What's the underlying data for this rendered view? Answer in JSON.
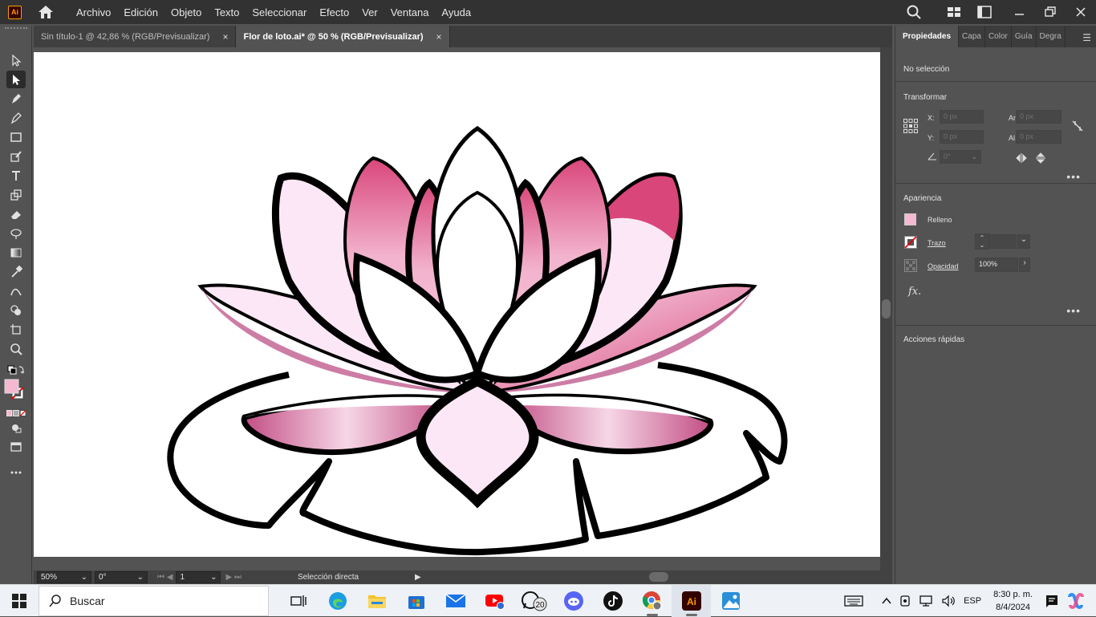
{
  "app": {
    "logo_text": "Ai"
  },
  "menu": [
    "Archivo",
    "Edición",
    "Objeto",
    "Texto",
    "Seleccionar",
    "Efecto",
    "Ver",
    "Ventana",
    "Ayuda"
  ],
  "tabs": [
    {
      "label": "Sin título-1 @ 42,86 % (RGB/Previsualizar)",
      "close": "×",
      "active": false
    },
    {
      "label": "Flor de loto.ai* @ 50 % (RGB/Previsualizar)",
      "close": "×",
      "active": true
    }
  ],
  "statusbar": {
    "zoom": "50%",
    "rotation": "0°",
    "artboard": "1",
    "tool": "Selección directa"
  },
  "panel": {
    "tabs": [
      "Propiedades",
      "Capa",
      "Color",
      "Guía",
      "Degra"
    ],
    "selection": "No selección",
    "transform": {
      "title": "Transformar",
      "x_label": "X:",
      "x_value": "0 px",
      "y_label": "Y:",
      "y_value": "0 px",
      "w_label": "An.:",
      "w_value": "0 px",
      "h_label": "Al.:",
      "h_value": "0 px",
      "angle_value": "0°"
    },
    "appearance": {
      "title": "Apariencia",
      "fill_label": "Relleno",
      "stroke_label": "Trazo",
      "opacity_label": "Opacidad",
      "opacity_value": "100%",
      "fx_label": "fx."
    },
    "quick_actions": "Acciones rápidas",
    "more": "•••"
  },
  "taskbar": {
    "search_placeholder": "Buscar",
    "whatsapp_badge": "20",
    "language": "ESP",
    "time": "8:30 p. m.",
    "date": "8/4/2024"
  },
  "colors": {
    "fill_swatch": "#f4b8d0",
    "pink_dark": "#d9467a",
    "pink_light": "#fbe7f5"
  }
}
